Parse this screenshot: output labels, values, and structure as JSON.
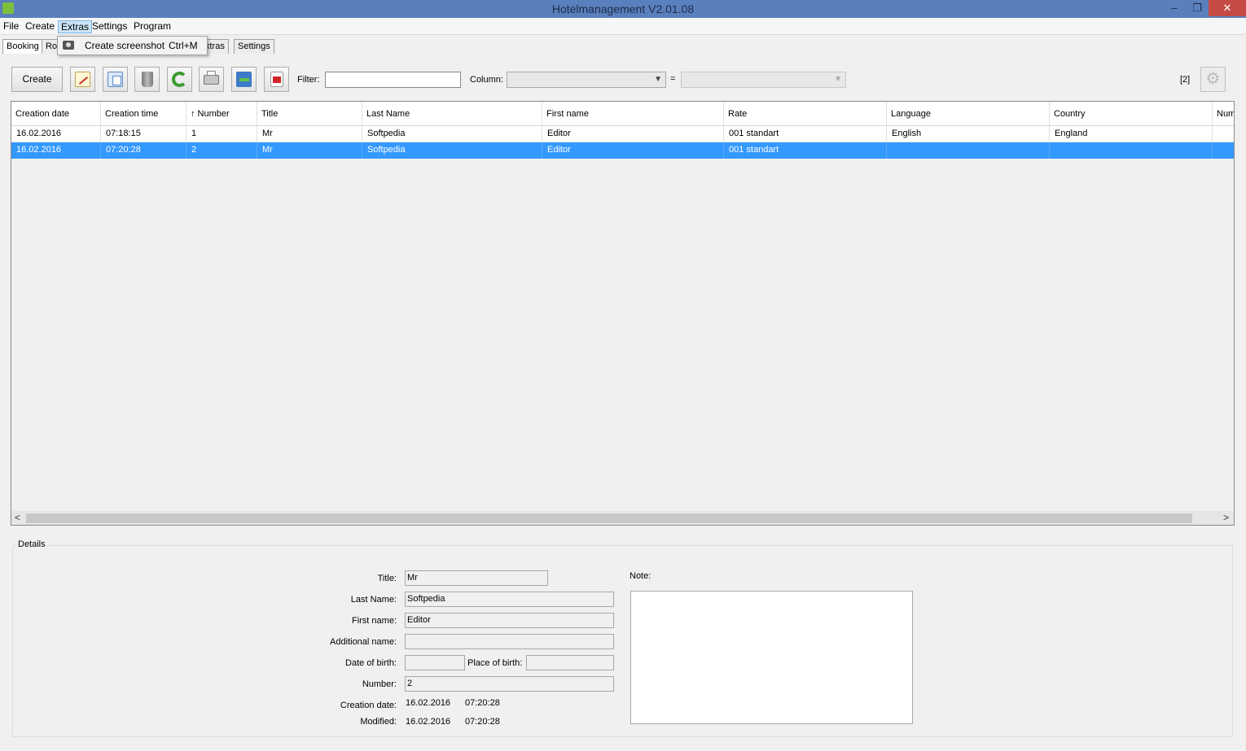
{
  "window": {
    "title": "Hotelmanagement V2.01.08",
    "minimize": "‒",
    "restore": "❐",
    "close": "✕"
  },
  "menu": [
    "File",
    "Create",
    "Extras",
    "Settings",
    "Program"
  ],
  "tabs": [
    "Booking",
    "Ro",
    "xtras",
    "Settings"
  ],
  "extras_menu": {
    "item_label": "Create screenshot",
    "shortcut": "Ctrl+M",
    "icon": "camera-icon"
  },
  "toolbar": {
    "create_label": "Create",
    "icons": [
      "edit-icon",
      "copy-icon",
      "delete-icon",
      "refresh-icon",
      "print-icon",
      "export-icon",
      "pdf-icon"
    ],
    "filter_label": "Filter:",
    "filter_value": "",
    "column_label": "Column:",
    "column_value": "",
    "equals": "=",
    "value_value": "",
    "count": "[2]",
    "gear": "⚙"
  },
  "grid": {
    "columns": [
      "Creation date",
      "Creation time",
      "↑ Number",
      "Title",
      "Last Name",
      "First name",
      "Rate",
      "Language",
      "Country",
      "Num"
    ],
    "rows": [
      [
        "16.02.2016",
        "07:18:15",
        "1",
        "Mr",
        "Softpedia",
        "Editor",
        "001 standart",
        "English",
        "England",
        ""
      ],
      [
        "16.02.2016",
        "07:20:28",
        "2",
        "Mr",
        "Softpedia",
        "Editor",
        "001 standart",
        "",
        "",
        ""
      ]
    ],
    "selected_row": 1,
    "scroll_left": "<",
    "scroll_right": ">"
  },
  "details": {
    "legend": "Details",
    "title_label": "Title:",
    "title_value": "Mr",
    "last_name_label": "Last Name:",
    "last_name_value": "Softpedia",
    "first_name_label": "First name:",
    "first_name_value": "Editor",
    "additional_name_label": "Additional name:",
    "additional_name_value": "",
    "dob_label": "Date of birth:",
    "dob_value": "",
    "pob_label": "Place of birth:",
    "pob_value": "",
    "number_label": "Number:",
    "number_value": "2",
    "creation_date_label": "Creation date:",
    "creation_date_value": "16.02.2016",
    "creation_time_value": "07:20:28",
    "modified_label": "Modified:",
    "modified_date_value": "16.02.2016",
    "modified_time_value": "07:20:28",
    "note_label": "Note:",
    "note_value": ""
  },
  "colors": {
    "titlebar": "#5a7fbd",
    "selection": "#3399ff",
    "close": "#c64b45"
  }
}
